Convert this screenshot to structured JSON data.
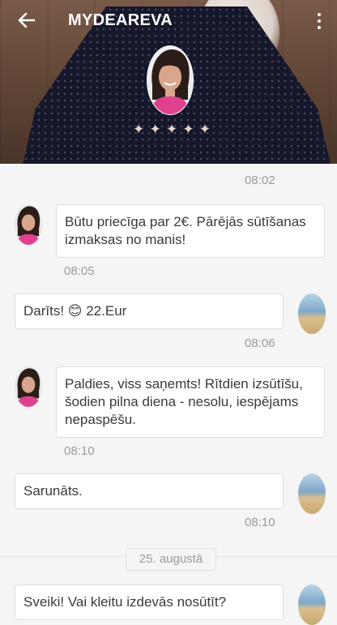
{
  "header": {
    "title": "MYDEAREVA",
    "back_icon": "arrow-left-icon",
    "menu_icon": "more-vertical-icon",
    "rating": {
      "stars": [
        "✦",
        "✦",
        "✦",
        "✦",
        "✦"
      ],
      "icon": "star-icon",
      "color": "#e8d7c4"
    }
  },
  "chat": {
    "messages": [
      {
        "from": "me",
        "text": "",
        "time": "08:02"
      },
      {
        "from": "her",
        "text": "Būtu priecīga par 2€. Pārējās sūtīšanas izmaksas no manis!",
        "time": "08:05"
      },
      {
        "from": "me",
        "text": "Darīts! 😊 22.Eur",
        "time": "08:06"
      },
      {
        "from": "her",
        "text": "Paldies,  viss saņemts!  Rītdien izsūtīšu,  šodien pilna diena - nesolu, iespējams nepaspēšu.",
        "time": "08:10"
      },
      {
        "from": "me",
        "text": "Sarunāts.",
        "time": "08:10"
      },
      {
        "from": "me",
        "text": "Sveiki! Vai kleitu izdevās nosūtīt?",
        "time": ""
      }
    ],
    "date_separator": "25. augustā"
  },
  "colors": {
    "header_text": "#ffffff",
    "bubble_bg": "#ffffff",
    "chat_bg": "#f5f5f5",
    "timestamp": "#9a9a9a"
  }
}
